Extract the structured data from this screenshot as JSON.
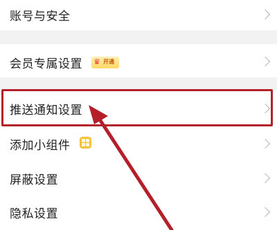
{
  "settings": {
    "account_security": "账号与安全",
    "member_settings": "会员专属设置",
    "member_badge": "开通",
    "push_notification": "推送通知设置",
    "add_widget": "添加小组件",
    "block_settings": "屏蔽设置",
    "privacy_settings": "隐私设置"
  },
  "colors": {
    "highlight": "#b3202a",
    "separator": "#f2f2f2",
    "chevron": "#b5b5b5"
  }
}
